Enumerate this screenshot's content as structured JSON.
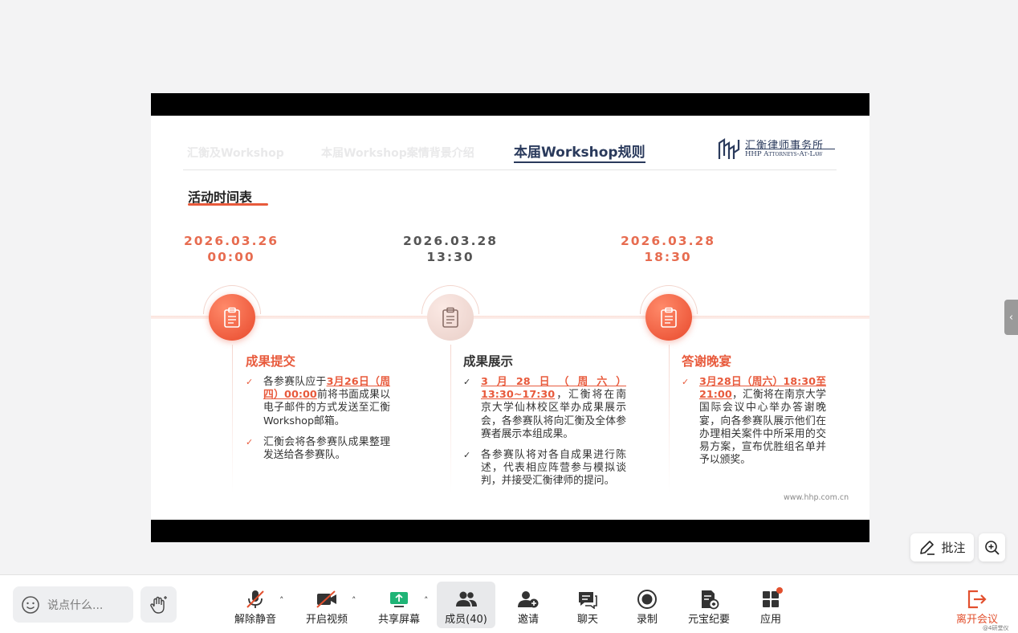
{
  "slide": {
    "nav": {
      "tab1": "汇衡及Workshop",
      "tab2": "本届Workshop案情背景介绍",
      "active": "本届Workshop规则"
    },
    "logo": {
      "cn": "汇衡律师事务所",
      "en": "HHP Attorneys-At-Law"
    },
    "section_title": "活动时间表",
    "timeline": [
      {
        "date": "2026.03.26",
        "time": "00:00",
        "title": "成果提交",
        "bullets": [
          {
            "pre": "各参赛队应于",
            "hl": "3月26日（周四）00:00",
            "post": "前将书面成果以电子邮件的方式发送至汇衡Workshop邮箱。"
          },
          {
            "pre": "汇衡会将各参赛队成果整理发送给各参赛队。",
            "hl": "",
            "post": ""
          }
        ]
      },
      {
        "date": "2026.03.28",
        "time": "13:30",
        "title": "成果展示",
        "bullets": [
          {
            "pre": "",
            "hl": "3月28日（周六）13:30~17:30",
            "post": "，汇衡将在南京大学仙林校区举办成果展示会，各参赛队将向汇衡及全体参赛者展示本组成果。"
          },
          {
            "pre": "各参赛队将对各自成果进行陈述，代表相应阵营参与模拟谈判，并接受汇衡律师的提问。",
            "hl": "",
            "post": ""
          }
        ]
      },
      {
        "date": "2026.03.28",
        "time": "18:30",
        "title": "答谢晚宴",
        "bullets": [
          {
            "pre": "",
            "hl": "3月28日（周六）18:30至21:00",
            "post": "，汇衡将在南京大学国际会议中心举办答谢晚宴，向各参赛队展示他们在办理相关案件中所采用的交易方案，宣布优胜组名单并予以颁奖。"
          }
        ]
      }
    ],
    "url": "www.hhp.com.cn"
  },
  "controls": {
    "annotate_label": "批注"
  },
  "toolbar": {
    "chat_placeholder": "说点什么...",
    "unmute": "解除静音",
    "video": "开启视频",
    "share": "共享屏幕",
    "members": "成员(40)",
    "invite": "邀请",
    "chat": "聊天",
    "record": "录制",
    "summary": "元宝纪要",
    "apps": "应用",
    "leave": "离开会议"
  },
  "watermark": "@4研堂仪",
  "colors": {
    "accent": "#e85a3c",
    "navy": "#2a3a5c",
    "leave": "#e2502e"
  }
}
